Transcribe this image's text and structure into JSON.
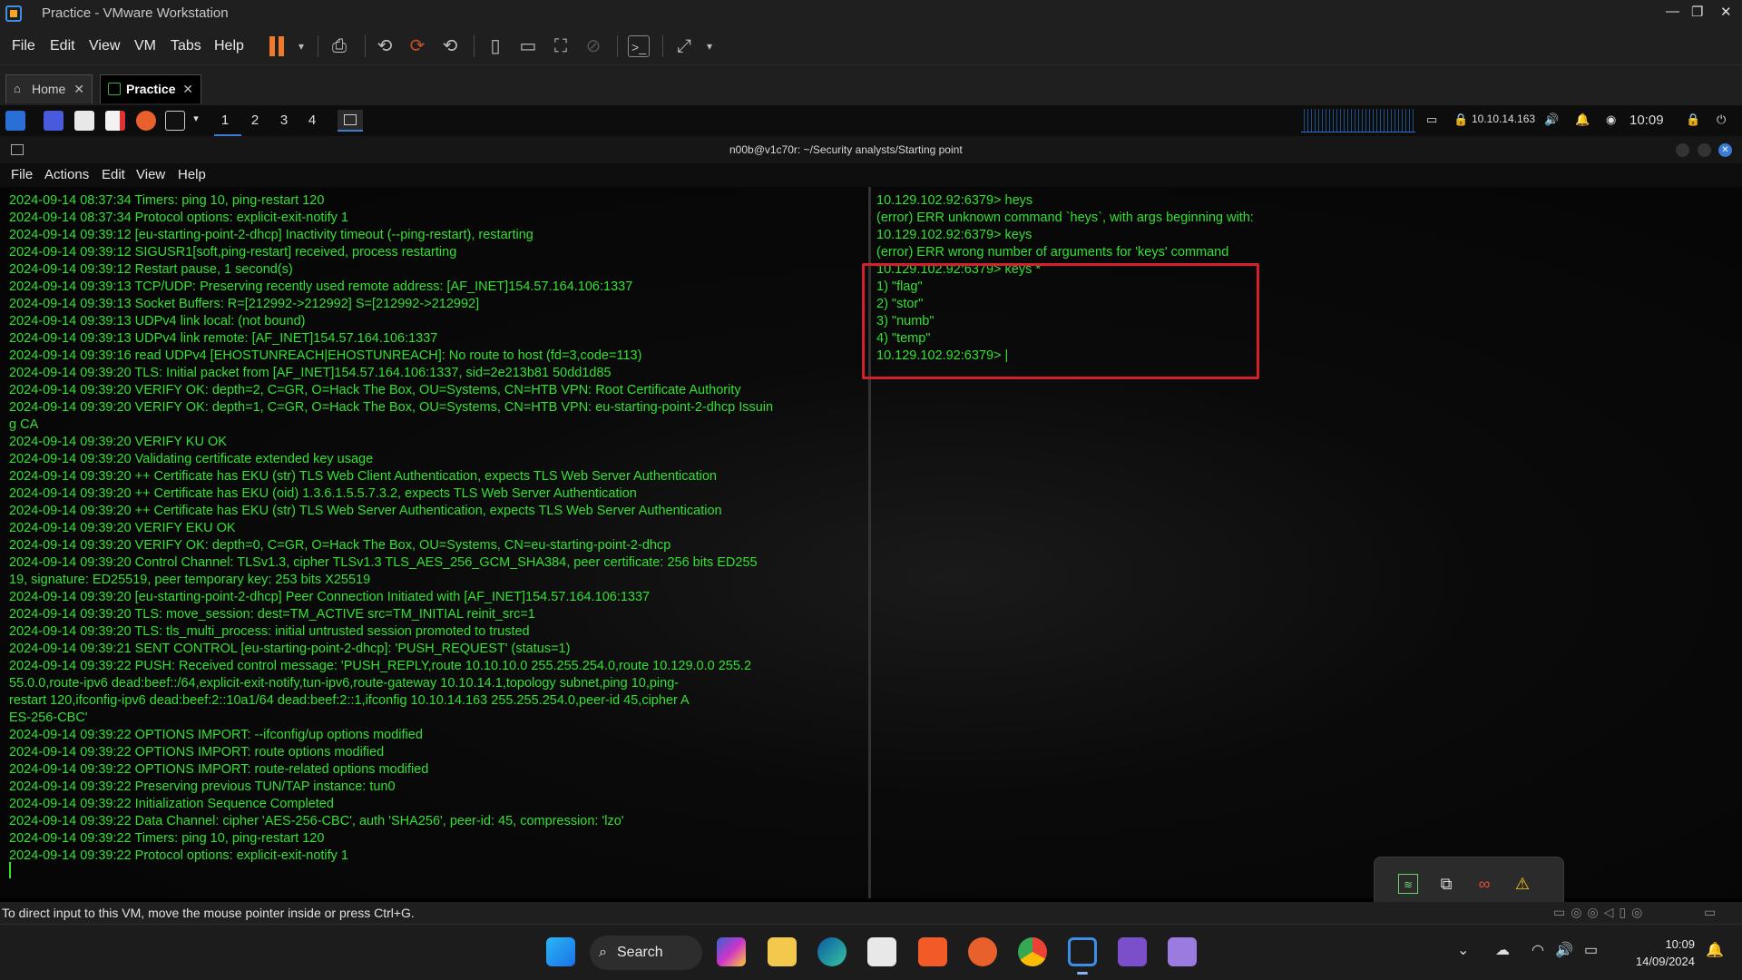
{
  "window": {
    "title": "Practice - VMware Workstation",
    "minimize": "—",
    "maximize": "❐",
    "close": "✕"
  },
  "menu": [
    "File",
    "Edit",
    "View",
    "VM",
    "Tabs",
    "Help"
  ],
  "tabs": [
    {
      "label": "Home"
    },
    {
      "label": "Practice"
    }
  ],
  "kali_panel": {
    "workspaces": [
      "1",
      "2",
      "3",
      "4"
    ],
    "ip": "10.10.14.163",
    "time": "10:09"
  },
  "terminal": {
    "title": "n00b@v1c70r: ~/Security analysts/Starting point",
    "menu": [
      "File",
      "Actions",
      "Edit",
      "View",
      "Help"
    ],
    "left_lines": [
      "2024-09-14 08:37:34 Timers: ping 10, ping-restart 120",
      "2024-09-14 08:37:34 Protocol options: explicit-exit-notify 1",
      "2024-09-14 09:39:12 [eu-starting-point-2-dhcp] Inactivity timeout (--ping-restart), restarting",
      "2024-09-14 09:39:12 SIGUSR1[soft,ping-restart] received, process restarting",
      "2024-09-14 09:39:12 Restart pause, 1 second(s)",
      "2024-09-14 09:39:13 TCP/UDP: Preserving recently used remote address: [AF_INET]154.57.164.106:1337",
      "2024-09-14 09:39:13 Socket Buffers: R=[212992->212992] S=[212992->212992]",
      "2024-09-14 09:39:13 UDPv4 link local: (not bound)",
      "2024-09-14 09:39:13 UDPv4 link remote: [AF_INET]154.57.164.106:1337",
      "2024-09-14 09:39:16 read UDPv4 [EHOSTUNREACH|EHOSTUNREACH]: No route to host (fd=3,code=113)",
      "2024-09-14 09:39:20 TLS: Initial packet from [AF_INET]154.57.164.106:1337, sid=2e213b81 50dd1d85",
      "2024-09-14 09:39:20 VERIFY OK: depth=2, C=GR, O=Hack The Box, OU=Systems, CN=HTB VPN: Root Certificate Authority",
      "2024-09-14 09:39:20 VERIFY OK: depth=1, C=GR, O=Hack The Box, OU=Systems, CN=HTB VPN: eu-starting-point-2-dhcp Issuin",
      "g CA",
      "2024-09-14 09:39:20 VERIFY KU OK",
      "2024-09-14 09:39:20 Validating certificate extended key usage",
      "2024-09-14 09:39:20 ++ Certificate has EKU (str) TLS Web Client Authentication, expects TLS Web Server Authentication",
      "2024-09-14 09:39:20 ++ Certificate has EKU (oid) 1.3.6.1.5.5.7.3.2, expects TLS Web Server Authentication",
      "2024-09-14 09:39:20 ++ Certificate has EKU (str) TLS Web Server Authentication, expects TLS Web Server Authentication",
      "2024-09-14 09:39:20 VERIFY EKU OK",
      "2024-09-14 09:39:20 VERIFY OK: depth=0, C=GR, O=Hack The Box, OU=Systems, CN=eu-starting-point-2-dhcp",
      "2024-09-14 09:39:20 Control Channel: TLSv1.3, cipher TLSv1.3 TLS_AES_256_GCM_SHA384, peer certificate: 256 bits ED255",
      "19, signature: ED25519, peer temporary key: 253 bits X25519",
      "2024-09-14 09:39:20 [eu-starting-point-2-dhcp] Peer Connection Initiated with [AF_INET]154.57.164.106:1337",
      "2024-09-14 09:39:20 TLS: move_session: dest=TM_ACTIVE src=TM_INITIAL reinit_src=1",
      "2024-09-14 09:39:20 TLS: tls_multi_process: initial untrusted session promoted to trusted",
      "2024-09-14 09:39:21 SENT CONTROL [eu-starting-point-2-dhcp]: 'PUSH_REQUEST' (status=1)",
      "2024-09-14 09:39:22 PUSH: Received control message: 'PUSH_REPLY,route 10.10.10.0 255.255.254.0,route 10.129.0.0 255.2",
      "55.0.0,route-ipv6 dead:beef::/64,explicit-exit-notify,tun-ipv6,route-gateway 10.10.14.1,topology subnet,ping 10,ping-",
      "restart 120,ifconfig-ipv6 dead:beef:2::10a1/64 dead:beef:2::1,ifconfig 10.10.14.163 255.255.254.0,peer-id 45,cipher A",
      "ES-256-CBC'",
      "2024-09-14 09:39:22 OPTIONS IMPORT: --ifconfig/up options modified",
      "2024-09-14 09:39:22 OPTIONS IMPORT: route options modified",
      "2024-09-14 09:39:22 OPTIONS IMPORT: route-related options modified",
      "2024-09-14 09:39:22 Preserving previous TUN/TAP instance: tun0",
      "2024-09-14 09:39:22 Initialization Sequence Completed",
      "2024-09-14 09:39:22 Data Channel: cipher 'AES-256-CBC', auth 'SHA256', peer-id: 45, compression: 'lzo'",
      "2024-09-14 09:39:22 Timers: ping 10, ping-restart 120",
      "2024-09-14 09:39:22 Protocol options: explicit-exit-notify 1"
    ],
    "right_lines": [
      "10.129.102.92:6379> heys",
      "(error) ERR unknown command `heys`, with args beginning with:",
      "10.129.102.92:6379> keys",
      "(error) ERR wrong number of arguments for 'keys' command",
      "10.129.102.92:6379> keys *",
      "1) \"flag\"",
      "2) \"stor\"",
      "3) \"numb\"",
      "4) \"temp\"",
      "10.129.102.92:6379> |"
    ]
  },
  "status_bar": {
    "message": "To direct input to this VM, move the mouse pointer inside or press Ctrl+G."
  },
  "taskbar": {
    "search": "Search",
    "time": "10:09",
    "date": "14/09/2024"
  },
  "colors": {
    "terminal_text": "#33e033",
    "highlight_box": "#d51f2a",
    "pause_icon": "#f07a2a"
  }
}
